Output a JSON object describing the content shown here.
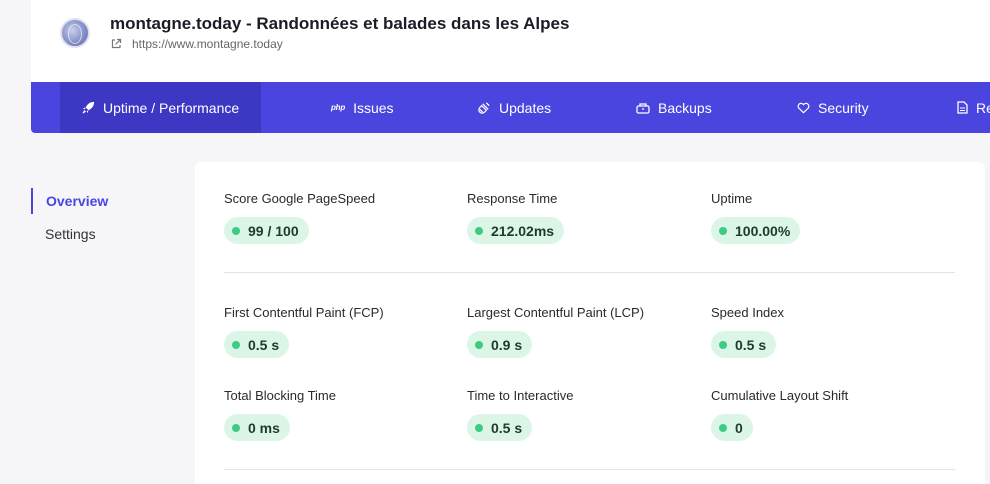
{
  "site": {
    "title": "montagne.today - Randonnées et balades dans les Alpes",
    "url": "https://www.montagne.today"
  },
  "nav": {
    "tabs": [
      {
        "label": "Uptime / Performance",
        "icon": "rocket-icon",
        "active": true
      },
      {
        "label": "Issues",
        "icon": "php-icon",
        "icon_text": "php"
      },
      {
        "label": "Updates",
        "icon": "plug-icon"
      },
      {
        "label": "Backups",
        "icon": "database-icon"
      },
      {
        "label": "Security",
        "icon": "heart-icon"
      },
      {
        "label": "Re",
        "icon": "document-icon"
      }
    ]
  },
  "sidebar": {
    "items": [
      {
        "label": "Overview",
        "active": true
      },
      {
        "label": "Settings"
      }
    ]
  },
  "metrics": {
    "pagespeed": {
      "label": "Score Google PageSpeed",
      "value": "99 / 100"
    },
    "response": {
      "label": "Response Time",
      "value": "212.02ms"
    },
    "uptime": {
      "label": "Uptime",
      "value": "100.00%"
    },
    "fcp": {
      "label": "First Contentful Paint (FCP)",
      "value": "0.5 s"
    },
    "lcp": {
      "label": "Largest Contentful Paint (LCP)",
      "value": "0.9 s"
    },
    "speed_index": {
      "label": "Speed Index",
      "value": "0.5 s"
    },
    "tbt": {
      "label": "Total Blocking Time",
      "value": "0 ms"
    },
    "tti": {
      "label": "Time to Interactive",
      "value": "0.5 s"
    },
    "cls": {
      "label": "Cumulative Layout Shift",
      "value": "0"
    }
  },
  "colors": {
    "accent": "#4b45e0",
    "badge_bg": "#dbf6e6",
    "badge_dot": "#3ecb84"
  }
}
